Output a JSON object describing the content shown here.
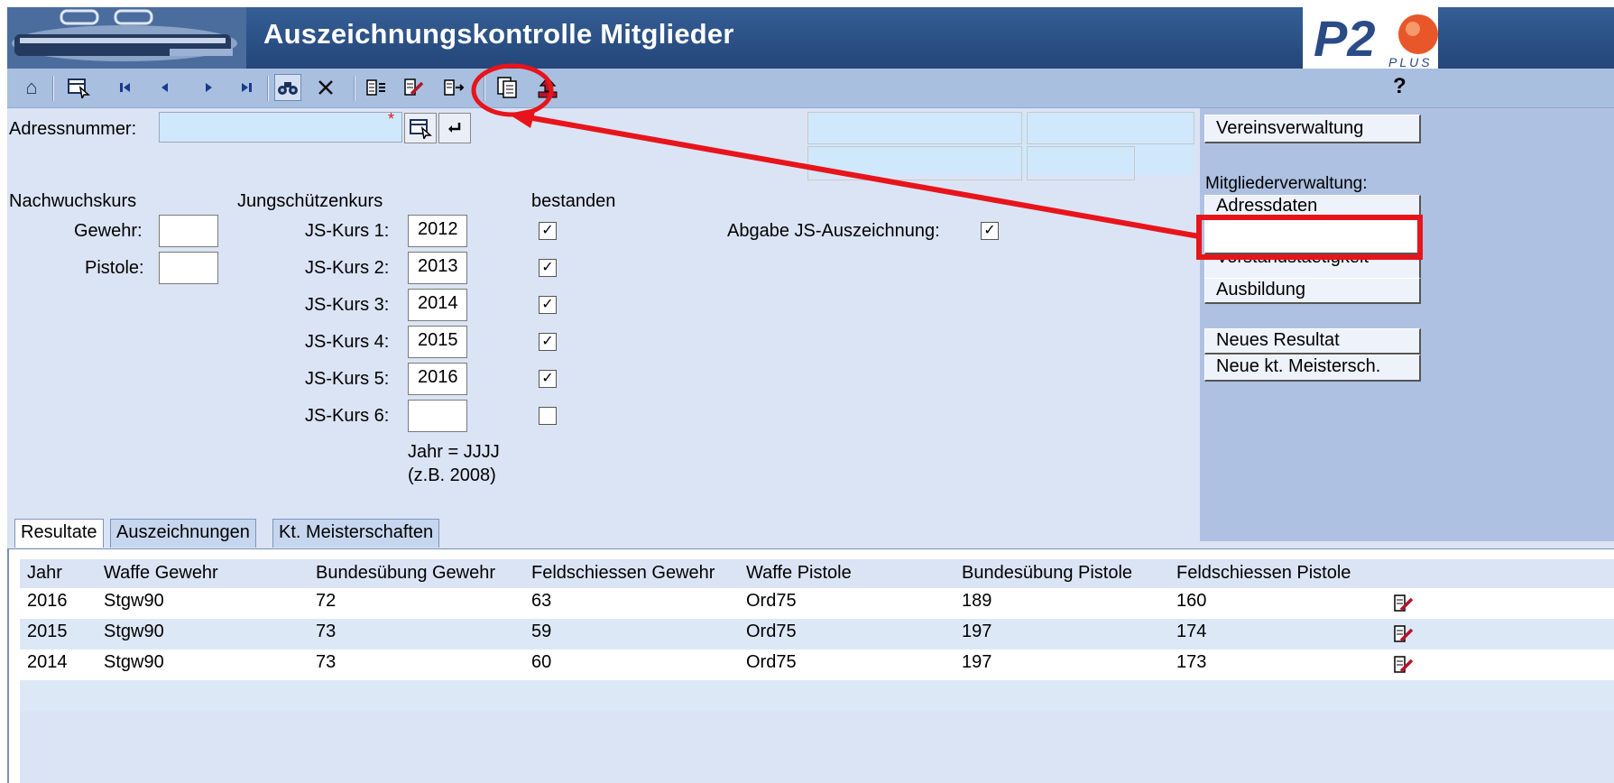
{
  "window": {
    "title": "Auszeichnungskontrolle Mitglieder",
    "logo_text": "P2",
    "logo_sub": "PLUS"
  },
  "toolbar": {
    "icons": [
      "home-icon",
      "select-record-icon",
      "first-record-icon",
      "previous-record-icon",
      "next-record-icon",
      "last-record-icon",
      "search-icon",
      "delete-icon",
      "insert-icon",
      "edit-icon",
      "new-record-icon",
      "copy-icon",
      "upload-icon"
    ],
    "help_label": "?"
  },
  "form": {
    "adressnummer_label": "Adressnummer:",
    "adressnummer_value": "",
    "nachwuchskurs_header": "Nachwuchskurs",
    "gewehr_label": "Gewehr:",
    "gewehr_value": "",
    "pistole_label": "Pistole:",
    "pistole_value": "",
    "jungschuetzenkurs_header": "Jungschützenkurs",
    "bestanden_header": "bestanden",
    "abgabe_label": "Abgabe JS-Auszeichnung:",
    "abgabe_checked": true,
    "js_kurse": [
      {
        "label": "JS-Kurs 1:",
        "year": "2012",
        "passed": true
      },
      {
        "label": "JS-Kurs 2:",
        "year": "2013",
        "passed": true
      },
      {
        "label": "JS-Kurs 3:",
        "year": "2014",
        "passed": true
      },
      {
        "label": "JS-Kurs 4:",
        "year": "2015",
        "passed": true
      },
      {
        "label": "JS-Kurs 5:",
        "year": "2016",
        "passed": true
      },
      {
        "label": "JS-Kurs 6:",
        "year": "",
        "passed": false
      }
    ],
    "jahr_hint_1": "Jahr = JJJJ",
    "jahr_hint_2": "(z.B. 2008)"
  },
  "sidebar": {
    "vereinsverwaltung": "Vereinsverwaltung",
    "mitgliederverwaltung_header": "Mitgliederverwaltung:",
    "adressdaten": "Adressdaten",
    "vorstandstaetigkeit": "Vorstandstaetigkeit",
    "ausbildung": "Ausbildung",
    "neues_resultat": "Neues Resultat",
    "neue_kt_meistersch": "Neue kt. Meistersch."
  },
  "tabs": [
    {
      "label": "Resultate",
      "active": true
    },
    {
      "label": "Auszeichnungen",
      "active": false
    },
    {
      "label": "Kt. Meisterschaften",
      "active": false
    }
  ],
  "table": {
    "columns": [
      "Jahr",
      "Waffe Gewehr",
      "Bundesübung Gewehr",
      "Feldschiessen Gewehr",
      "Waffe Pistole",
      "Bundesübung Pistole",
      "Feldschiessen Pistole"
    ],
    "rows": [
      [
        "2016",
        "Stgw90",
        "72",
        "63",
        "Ord75",
        "189",
        "160"
      ],
      [
        "2015",
        "Stgw90",
        "73",
        "59",
        "Ord75",
        "197",
        "174"
      ],
      [
        "2014",
        "Stgw90",
        "73",
        "60",
        "Ord75",
        "197",
        "173"
      ]
    ]
  },
  "colors": {
    "title_bar": "#2f5689",
    "toolbar": "#a9bfe0",
    "form_bg": "#dbe4f4",
    "sidebar_bg": "#aec1e2",
    "input_highlight": "#cfe8fb",
    "annotation": "#e8141b"
  }
}
